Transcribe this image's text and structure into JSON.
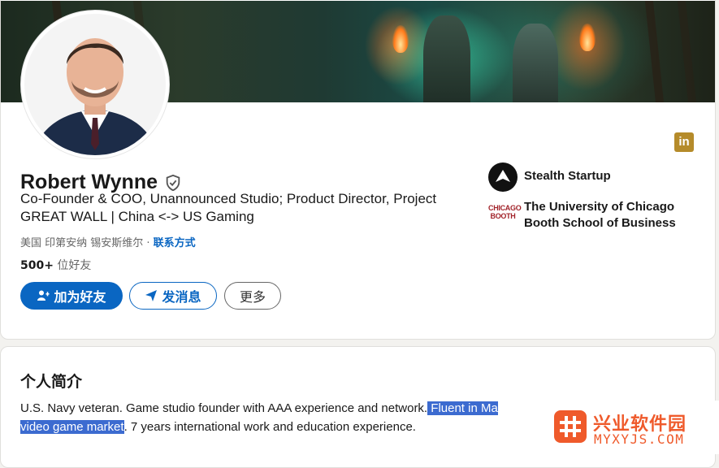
{
  "profile": {
    "name": "Robert Wynne",
    "headline": "Co-Founder & COO, Unannounced Studio; Product Director, Project GREAT WALL | China <-> US Gaming",
    "location": "美国 印第安纳 锡安斯维尔 · ",
    "contact_info": "联系方式",
    "connections_count": "500+",
    "connections_label": " 位好友",
    "verified_icon": "shield-check-icon",
    "social_icon": "linkedin-icon"
  },
  "actions": {
    "connect": "加为好友",
    "message": "发消息",
    "more": "更多"
  },
  "organizations": [
    {
      "name": "Stealth Startup"
    },
    {
      "name": "The University of Chicago Booth School of Business",
      "logo_text_1": "CHICAGO",
      "logo_text_2": "BOOTH"
    }
  ],
  "about": {
    "title": "个人简介",
    "text_before": "U.S. Navy veteran. Game studio founder with AAA experience and network.",
    "text_highlight_1": " Fluent in Ma",
    "text_highlight_2": "video game market",
    "text_after": ". 7 years international work and education experience."
  },
  "watermark": {
    "title": "兴业软件园",
    "url": "MYXYJS.COM"
  },
  "colors": {
    "accent": "#0a66c2",
    "selection": "#3c6bd0",
    "watermark": "#ef5a2b",
    "linkedin_badge": "#b58b2a"
  }
}
